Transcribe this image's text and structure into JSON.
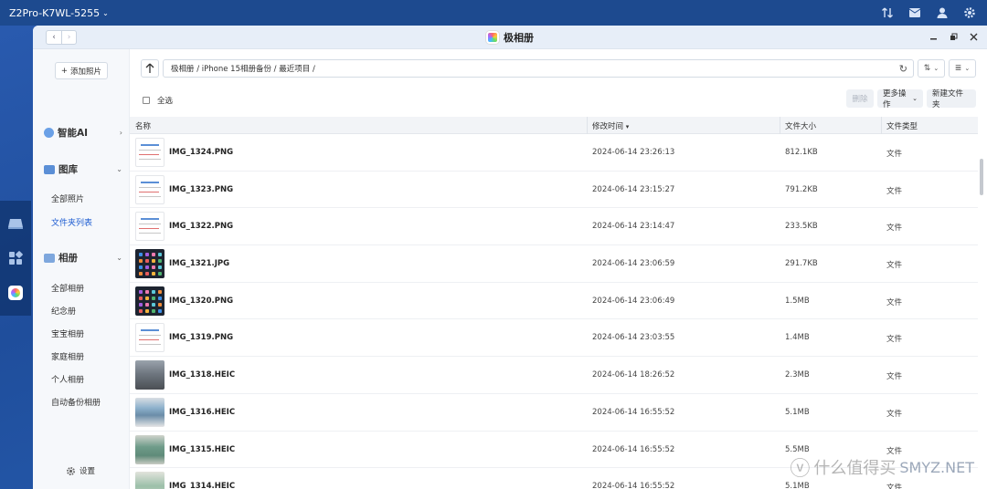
{
  "topbar": {
    "device_name": "Z2Pro-K7WL-5255"
  },
  "window": {
    "title": "极相册"
  },
  "sidebar": {
    "add_photo": "添加照片",
    "sections": [
      {
        "label": "智能AI"
      },
      {
        "label": "图库",
        "items": [
          "全部照片",
          "文件夹列表"
        ]
      },
      {
        "label": "相册",
        "items": [
          "全部相册",
          "纪念册",
          "宝宝相册",
          "家庭相册",
          "个人相册",
          "自动备份相册"
        ]
      }
    ],
    "settings": "设置"
  },
  "main": {
    "path": "极相册 / iPhone 15相册备份 / 最近项目 /",
    "select_all": "全选",
    "actions": {
      "delete": "删除",
      "more": "更多操作",
      "new_folder": "新建文件夹"
    },
    "columns": {
      "name": "名称",
      "mtime": "修改时间",
      "size": "文件大小",
      "type": "文件类型"
    },
    "rows": [
      {
        "name": "IMG_1324.PNG",
        "mtime": "2024-06-14 23:26:13",
        "size": "812.1KB",
        "type": "文件",
        "thumb": "doc"
      },
      {
        "name": "IMG_1323.PNG",
        "mtime": "2024-06-14 23:15:27",
        "size": "791.2KB",
        "type": "文件",
        "thumb": "doc"
      },
      {
        "name": "IMG_1322.PNG",
        "mtime": "2024-06-14 23:14:47",
        "size": "233.5KB",
        "type": "文件",
        "thumb": "doc"
      },
      {
        "name": "IMG_1321.JPG",
        "mtime": "2024-06-14 23:06:59",
        "size": "291.7KB",
        "type": "文件",
        "thumb": "phone"
      },
      {
        "name": "IMG_1320.PNG",
        "mtime": "2024-06-14 23:06:49",
        "size": "1.5MB",
        "type": "文件",
        "thumb": "phone"
      },
      {
        "name": "IMG_1319.PNG",
        "mtime": "2024-06-14 23:03:55",
        "size": "1.4MB",
        "type": "文件",
        "thumb": "doc"
      },
      {
        "name": "IMG_1318.HEIC",
        "mtime": "2024-06-14 18:26:52",
        "size": "2.3MB",
        "type": "文件",
        "thumb": "photo1"
      },
      {
        "name": "IMG_1316.HEIC",
        "mtime": "2024-06-14 16:55:52",
        "size": "5.1MB",
        "type": "文件",
        "thumb": "photo2"
      },
      {
        "name": "IMG_1315.HEIC",
        "mtime": "2024-06-14 16:55:52",
        "size": "5.5MB",
        "type": "文件",
        "thumb": "photo3"
      },
      {
        "name": "IMG_1314.HEIC",
        "mtime": "2024-06-14 16:55:52",
        "size": "5.1MB",
        "type": "文件",
        "thumb": "photo4"
      }
    ]
  },
  "watermark": {
    "text": "什么值得买",
    "sub": "SMYZ.NET"
  }
}
